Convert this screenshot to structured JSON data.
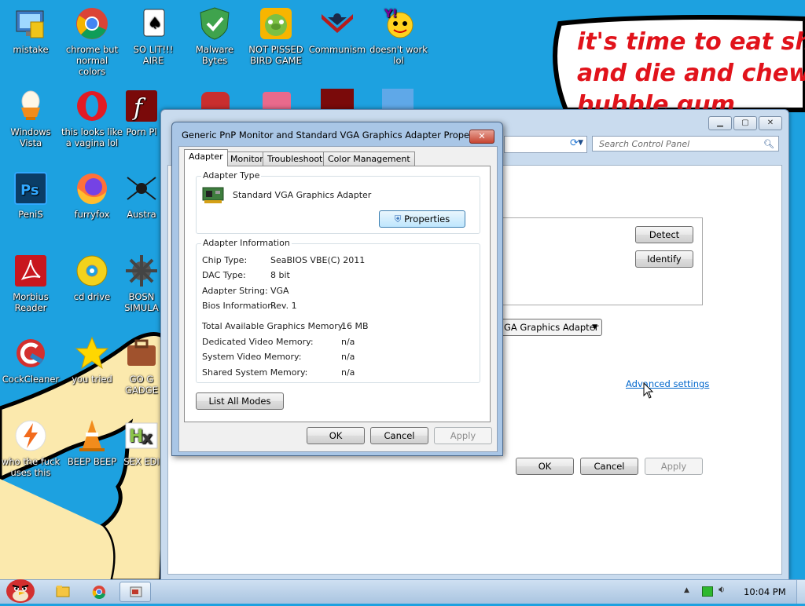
{
  "desktop": {
    "icons": [
      {
        "label": "mistake"
      },
      {
        "label": "chrome but normal colors"
      },
      {
        "label": "SO LIT!!! AIRE"
      },
      {
        "label": "Malware Bytes"
      },
      {
        "label": "NOT PISSED BIRD GAME"
      },
      {
        "label": "Communism"
      },
      {
        "label": "doesn't work lol"
      },
      {
        "label": "Windows Vista"
      },
      {
        "label": "this looks like a vagina lol"
      },
      {
        "label": "Porn Pl"
      },
      {
        "label": "PeniS"
      },
      {
        "label": "furryfox"
      },
      {
        "label": "Austra"
      },
      {
        "label": "Morbius Reader"
      },
      {
        "label": "cd drive"
      },
      {
        "label": "BOSN SIMULA"
      },
      {
        "label": "CockCleaner"
      },
      {
        "label": "you tried"
      },
      {
        "label": "GO G GADGE"
      },
      {
        "label": "who the fuck uses this"
      },
      {
        "label": "BEEP BEEP"
      },
      {
        "label": "SEX EDI"
      }
    ],
    "speech_bubble": {
      "lines": [
        "it's time to eat shit",
        "and die and chew",
        "bubble gum"
      ]
    }
  },
  "control_panel": {
    "search_placeholder": "Search Control Panel",
    "buttons": {
      "detect": "Detect",
      "identify": "Identify",
      "ok": "OK",
      "cancel": "Cancel",
      "apply": "Apply"
    },
    "display_select": "GA Graphics Adapter",
    "advanced_link": "Advanced settings"
  },
  "dialog": {
    "title": "Generic PnP Monitor and Standard VGA Graphics Adapter Properties",
    "close_label": "✕",
    "tabs": [
      "Adapter",
      "Monitor",
      "Troubleshoot",
      "Color Management"
    ],
    "active_tab": "Adapter",
    "adapter_type": {
      "group_title": "Adapter Type",
      "name": "Standard VGA Graphics Adapter",
      "properties_button": "Properties"
    },
    "adapter_info": {
      "group_title": "Adapter Information",
      "rows": [
        {
          "label": "Chip Type:",
          "value": "SeaBIOS VBE(C) 2011"
        },
        {
          "label": "DAC Type:",
          "value": "8 bit"
        },
        {
          "label": "Adapter String:",
          "value": "VGA"
        },
        {
          "label": "Bios Information:",
          "value": "Rev. 1"
        }
      ],
      "memory_rows": [
        {
          "label": "Total Available Graphics Memory:",
          "value": "16 MB"
        },
        {
          "label": "Dedicated Video Memory:",
          "value": "n/a"
        },
        {
          "label": "System Video Memory:",
          "value": "n/a"
        },
        {
          "label": "Shared System Memory:",
          "value": "n/a"
        }
      ]
    },
    "list_all_modes": "List All Modes",
    "buttons": {
      "ok": "OK",
      "cancel": "Cancel",
      "apply": "Apply"
    }
  },
  "taskbar": {
    "clock": "10:04 PM"
  },
  "colors": {
    "desktop_bg": "#1da1e0",
    "speech_text": "#e1131b",
    "sand": "#fbe9ad",
    "link": "#0066cc"
  }
}
